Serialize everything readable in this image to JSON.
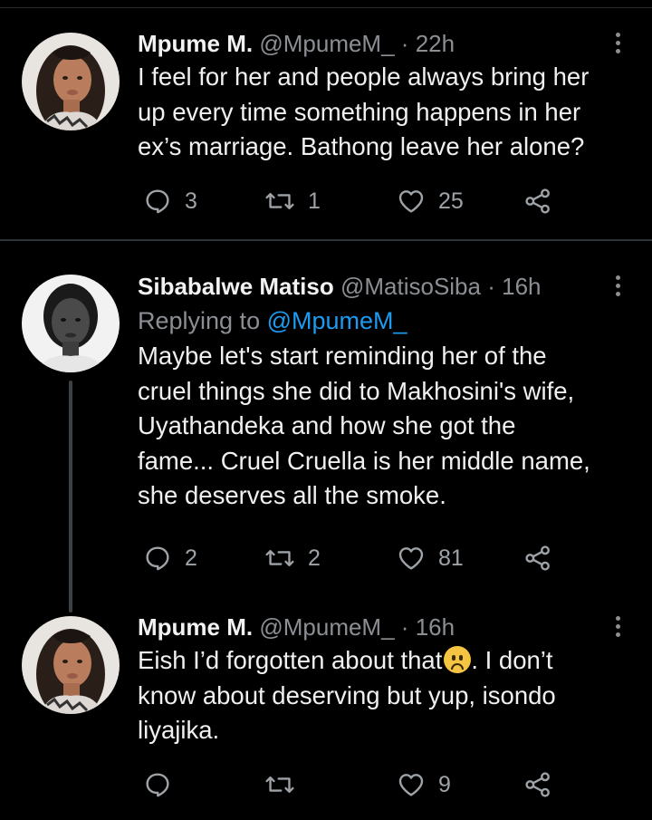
{
  "colors": {
    "background": "#000000",
    "accent": "#1d9bf0",
    "muted": "#8b8f94",
    "text": "#f0f0f0"
  },
  "tweets": [
    {
      "name": "Mpume M.",
      "handle": "@MpumeM_",
      "separator": "·",
      "time": "22h",
      "replying_label": "",
      "replying_to": "",
      "lines": [
        "I feel for her and people always bring her",
        "up every time something happens in her",
        "ex’s marriage. Bathong leave her alone?"
      ],
      "replies": "3",
      "retweets": "1",
      "likes": "25",
      "avatar_icon": "avatar-woman-braids"
    },
    {
      "name": "Sibabalwe Matiso",
      "handle": "@MatisoSiba",
      "separator": "·",
      "time": "16h",
      "replying_label": "Replying to",
      "replying_to": "@MpumeM_",
      "lines": [
        "Maybe let's start reminding her of the",
        "cruel things she did to Makhosini's wife,",
        "Uyathandeka and how she got the",
        "fame... Cruel Cruella is her middle name,",
        "she deserves all the smoke."
      ],
      "replies": "2",
      "retweets": "2",
      "likes": "81",
      "avatar_icon": "avatar-woman-grayscale"
    },
    {
      "name": "Mpume M.",
      "handle": "@MpumeM_",
      "separator": "·",
      "time": "16h",
      "replying_label": "",
      "replying_to": "",
      "line1_before_emoji": "Eish I’d forgotten about that",
      "emoji": "frowning-face-emoji",
      "line1_after_emoji": ". I don’t",
      "lines": [
        "know about deserving but yup, isondo",
        "liyajika."
      ],
      "replies": "",
      "retweets": "",
      "likes": "9",
      "avatar_icon": "avatar-woman-braids"
    }
  ]
}
